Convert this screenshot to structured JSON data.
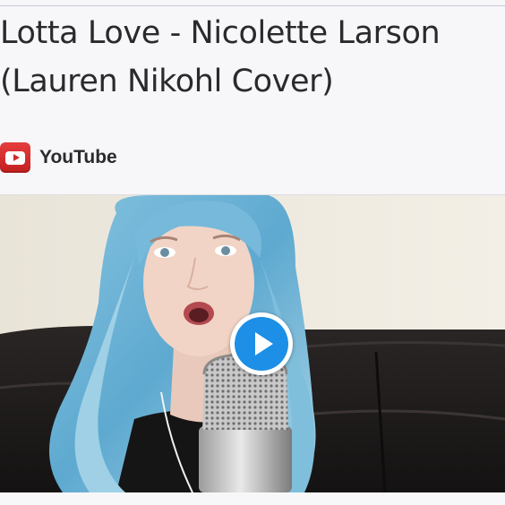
{
  "card": {
    "title": "Lotta Love - Nicolette Larson (Lauren Nikohl Cover)",
    "title_line1": "Lotta Love - Nicolette Larson",
    "title_line2": "(Lauren Nikohl Cover)",
    "source": {
      "name": "YouTube",
      "icon": "youtube-icon",
      "brand_color": "#d62b2b"
    }
  },
  "video": {
    "thumbnail": "woman-with-blue-hair-singing-into-microphone",
    "play_icon": "play-icon",
    "play_color": "#1d8fe6"
  }
}
